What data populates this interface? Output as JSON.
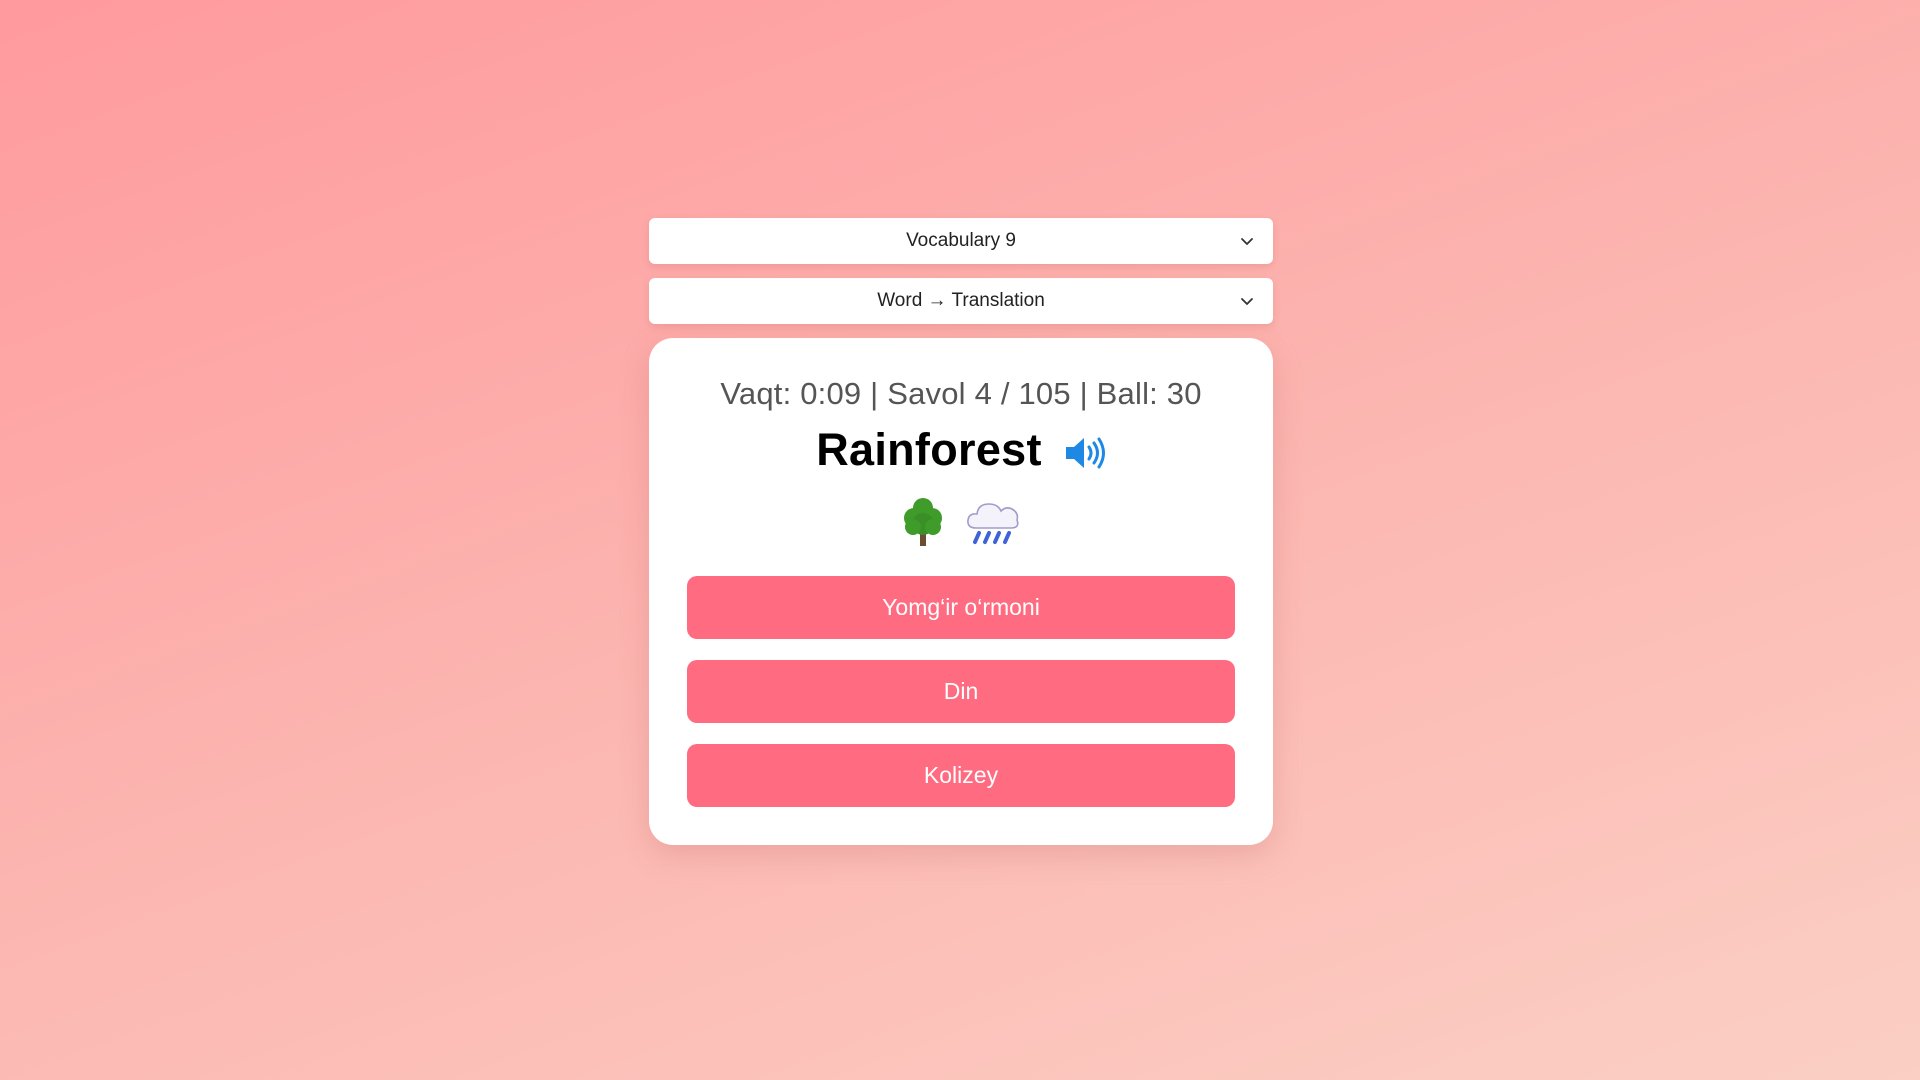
{
  "selects": {
    "vocabulary": "Vocabulary 9",
    "mode": "Word → Translation"
  },
  "quiz": {
    "stats": "Vaqt: 0:09 | Savol 4 / 105 | Ball: 30",
    "word": "Rainforest",
    "hint_icons": [
      "deciduous-tree-icon",
      "cloud-with-rain-icon"
    ]
  },
  "answers": [
    {
      "label": "Yomg‘ir o‘rmoni"
    },
    {
      "label": "Din"
    },
    {
      "label": "Kolizey"
    }
  ],
  "colors": {
    "answer_button": "#ff6b81",
    "speaker_icon": "#1e88e5",
    "background_start": "#ff9a9e",
    "background_end": "#fbcfc4"
  }
}
